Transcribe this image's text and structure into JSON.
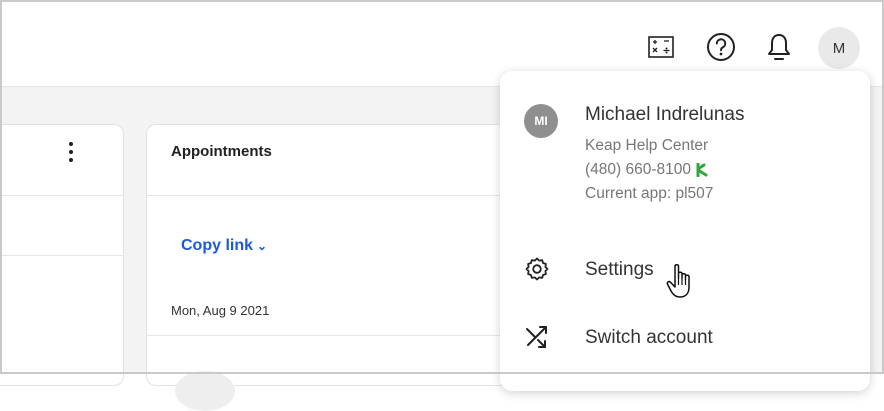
{
  "header": {
    "calculator_icon": "calculator-icon",
    "help_icon": "help-icon",
    "bell_icon": "notification-bell-icon",
    "avatar_initial": "M"
  },
  "left_panel": {},
  "appointments": {
    "title": "Appointments",
    "copy_link": "Copy link",
    "date": "Mon, Aug 9 2021"
  },
  "account_menu": {
    "avatar_initials": "MI",
    "user_name": "Michael Indrelunas",
    "org": "Keap Help Center",
    "phone": "(480) 660-8100",
    "current_app": "Current app: pl507",
    "items": [
      {
        "label": "Settings",
        "icon": "gear-icon"
      },
      {
        "label": "Switch account",
        "icon": "switch-account-icon"
      }
    ]
  },
  "colors": {
    "link_blue": "#1c5bd8",
    "phone_badge_green": "#2eaa3c",
    "avatar_gray": "#8f8f8f"
  }
}
